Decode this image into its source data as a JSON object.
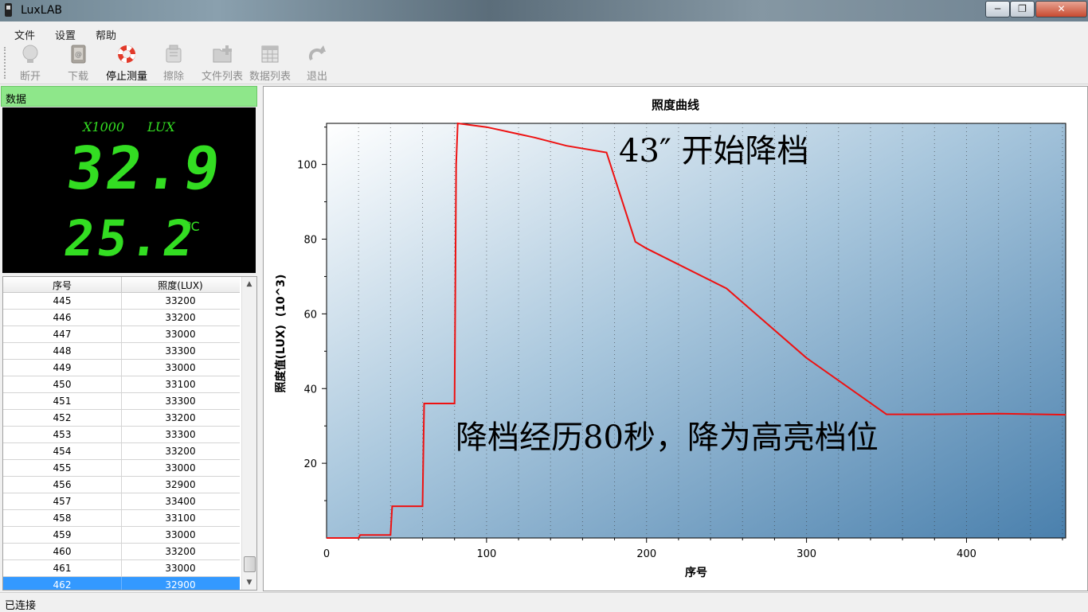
{
  "window": {
    "title": "LuxLAB",
    "min": "─",
    "max": "❐",
    "close": "✕"
  },
  "menu": [
    "文件",
    "设置",
    "帮助"
  ],
  "toolbar": [
    {
      "label": "断开",
      "icon": "bulb-icon",
      "enabled": false
    },
    {
      "label": "下载",
      "icon": "book-download-icon",
      "enabled": false
    },
    {
      "label": "停止测量",
      "icon": "lifebuoy-icon",
      "enabled": true
    },
    {
      "label": "擦除",
      "icon": "eraser-icon",
      "enabled": false
    },
    {
      "label": "文件列表",
      "icon": "folder-add-icon",
      "enabled": false
    },
    {
      "label": "数据列表",
      "icon": "calendar-table-icon",
      "enabled": false
    },
    {
      "label": "退出",
      "icon": "redo-icon",
      "enabled": false
    }
  ],
  "panel": {
    "header": "数据",
    "display": {
      "scale": "X1000",
      "unit": "LUX",
      "lux": "32.9",
      "temp": "25.2",
      "temp_unit": "℃"
    }
  },
  "table": {
    "columns": [
      "序号",
      "照度(LUX)"
    ],
    "rows": [
      [
        "445",
        "33200"
      ],
      [
        "446",
        "33200"
      ],
      [
        "447",
        "33000"
      ],
      [
        "448",
        "33300"
      ],
      [
        "449",
        "33000"
      ],
      [
        "450",
        "33100"
      ],
      [
        "451",
        "33300"
      ],
      [
        "452",
        "33200"
      ],
      [
        "453",
        "33300"
      ],
      [
        "454",
        "33200"
      ],
      [
        "455",
        "33000"
      ],
      [
        "456",
        "32900"
      ],
      [
        "457",
        "33400"
      ],
      [
        "458",
        "33100"
      ],
      [
        "459",
        "33000"
      ],
      [
        "460",
        "33200"
      ],
      [
        "461",
        "33000"
      ],
      [
        "462",
        "32900"
      ]
    ],
    "selected_index": 17
  },
  "chart_data": {
    "type": "line",
    "title": "照度曲线",
    "xlabel": "序号",
    "ylabel": "照度值(LUX)  (10^3)",
    "xlim": [
      0,
      462
    ],
    "ylim": [
      0,
      111
    ],
    "xticks": [
      0,
      100,
      200,
      300,
      400
    ],
    "yticks": [
      20,
      40,
      60,
      80,
      100
    ],
    "line_color": "#ee1111",
    "series": [
      {
        "x": [
          0,
          20,
          21,
          40,
          41,
          60,
          61,
          80,
          81,
          82,
          100,
          130,
          150,
          175,
          193,
          200,
          250,
          300,
          350,
          380,
          420,
          462
        ],
        "y": [
          0,
          0,
          0.8,
          0.8,
          8.5,
          8.5,
          36,
          36,
          100,
          111,
          110,
          107.2,
          105,
          103.2,
          79.3,
          77.5,
          66.8,
          48.2,
          33.1,
          33.1,
          33.3,
          33
        ]
      }
    ],
    "annotations": [
      "43″ 开始降档",
      "降档经历80秒，降为高亮档位"
    ]
  },
  "status": "已连接"
}
